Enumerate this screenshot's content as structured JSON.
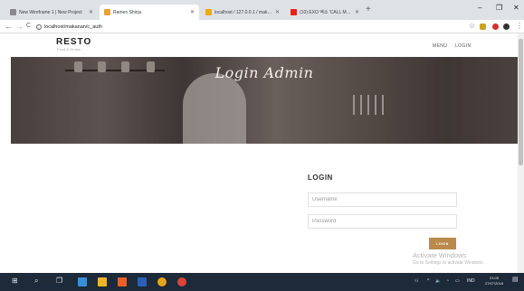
{
  "browser": {
    "tabs": [
      {
        "title": "New Wireframe 1 | New Project",
        "favicon_color": "#8a8a8a",
        "active": false
      },
      {
        "title": "Ramen Shinju",
        "favicon_color": "#e8a23a",
        "active": true
      },
      {
        "title": "localhost / 127.0.0.1 / makanan",
        "favicon_color": "#f2a900",
        "active": false
      },
      {
        "title": "(10) EXO 엑소 'CALL ME BABY' |",
        "favicon_color": "#e62117",
        "active": false
      }
    ],
    "new_tab": "+",
    "window_controls": {
      "minimize": "–",
      "maximize": "❐",
      "close": "✕"
    },
    "address": "localhost/makanan/c_auth",
    "nav": {
      "back": "←",
      "forward": "→",
      "reload": "C"
    }
  },
  "site": {
    "logo": "RESTO",
    "logo_tagline": "Food & Drinks",
    "menu": [
      "MENU",
      "LOGIN"
    ],
    "hero_title": "Login Admin",
    "login": {
      "title": "LOGIN",
      "username_placeholder": "Username",
      "password_placeholder": "Password",
      "button": "LOGIN"
    }
  },
  "watermark": {
    "line1": "Activate Windows",
    "line2": "Go to Settings to activate Windows."
  },
  "taskbar": {
    "start": "⊞",
    "search": "⌕",
    "taskview": "❐",
    "language": "IND",
    "time": "23.05",
    "date": "27/07/2018"
  },
  "colors": {
    "accent": "#b98a4b",
    "taskbar": "#1c2a3a",
    "tabstrip": "#dee1e6"
  }
}
